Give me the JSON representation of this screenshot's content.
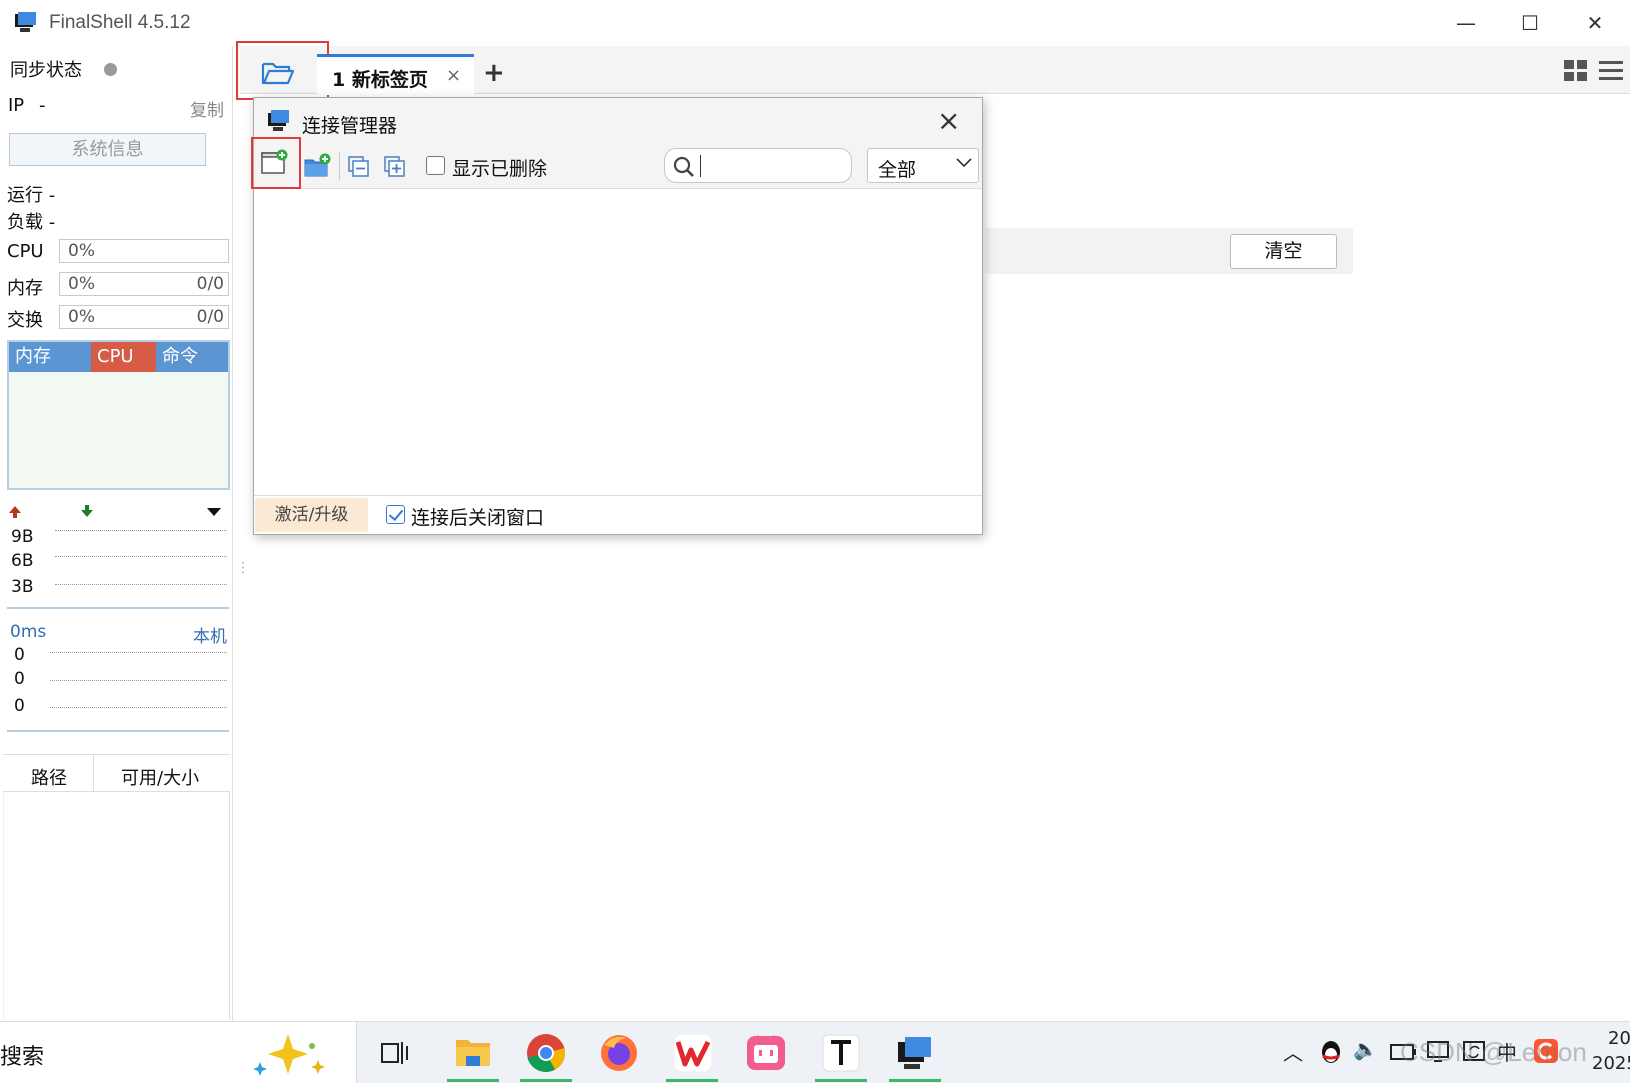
{
  "window": {
    "title": "FinalShell 4.5.12"
  },
  "sidebar": {
    "sync_status": "同步状态",
    "ip_label": "IP",
    "ip_value": "-",
    "copy_label": "复制",
    "sysinfo_button": "系统信息",
    "runtime_label": "运行 -",
    "load_label": "负载 -",
    "cpu": {
      "label": "CPU",
      "value": "0%"
    },
    "memory": {
      "label": "内存",
      "value": "0%",
      "ratio": "0/0"
    },
    "swap": {
      "label": "交换",
      "value": "0%",
      "ratio": "0/0"
    },
    "process_tabs": [
      "内存",
      "CPU",
      "命令"
    ],
    "network": {
      "ticks": [
        "9B",
        "6B",
        "3B"
      ]
    },
    "ping": {
      "latency": "0ms",
      "target": "本机",
      "ticks": [
        "0",
        "0",
        "0"
      ]
    },
    "disk_columns": [
      "路径",
      "可用/大小"
    ]
  },
  "tabs": {
    "active_tab": "1 新标签页",
    "close_glyph": "×",
    "add_glyph": "+"
  },
  "background_panel": {
    "clear_button": "清空"
  },
  "dialog": {
    "title": "连接管理器",
    "show_deleted": "显示已删除",
    "search_placeholder": "",
    "filter_value": "全部",
    "activate_button": "激活/升级",
    "close_after_connect": "连接后关闭窗口"
  },
  "taskbar": {
    "search_text": "搜索",
    "clock_partial_1": "20",
    "clock_partial_2": "2025",
    "ime": "中"
  },
  "watermark": "CSDN @Lemon",
  "colors": {
    "accent_blue": "#2f7dd8",
    "highlight_red": "#e03a3a",
    "cpu_tab": "#d65c45",
    "mem_tab": "#5b96d3",
    "activate_bg": "#fbe9d3"
  }
}
